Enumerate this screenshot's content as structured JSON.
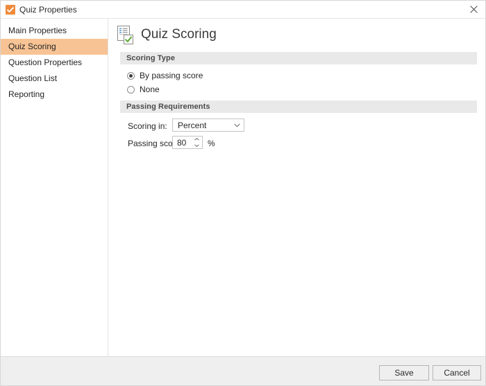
{
  "window": {
    "title": "Quiz Properties",
    "icon": "quiz-app-icon",
    "close_label": "×"
  },
  "sidebar": {
    "items": [
      {
        "label": "Main Properties",
        "selected": false
      },
      {
        "label": "Quiz Scoring",
        "selected": true
      },
      {
        "label": "Question Properties",
        "selected": false
      },
      {
        "label": "Question List",
        "selected": false
      },
      {
        "label": "Reporting",
        "selected": false
      }
    ],
    "selected_color": "#f7c394"
  },
  "main": {
    "page_title": "Quiz Scoring",
    "page_icon": "document-check-icon",
    "sections": [
      {
        "header": "Scoring Type",
        "radios": [
          {
            "label": "By passing score",
            "checked": true
          },
          {
            "label": "None",
            "checked": false
          }
        ]
      },
      {
        "header": "Passing Requirements",
        "fields": {
          "scoring_in_label": "Scoring in:",
          "scoring_in_value": "Percent",
          "passing_score_label": "Passing score:",
          "passing_score_value": "80",
          "passing_score_unit": "%"
        }
      }
    ],
    "section_header_bg": "#e9e9e9"
  },
  "footer": {
    "save_label": "Save",
    "cancel_label": "Cancel"
  }
}
